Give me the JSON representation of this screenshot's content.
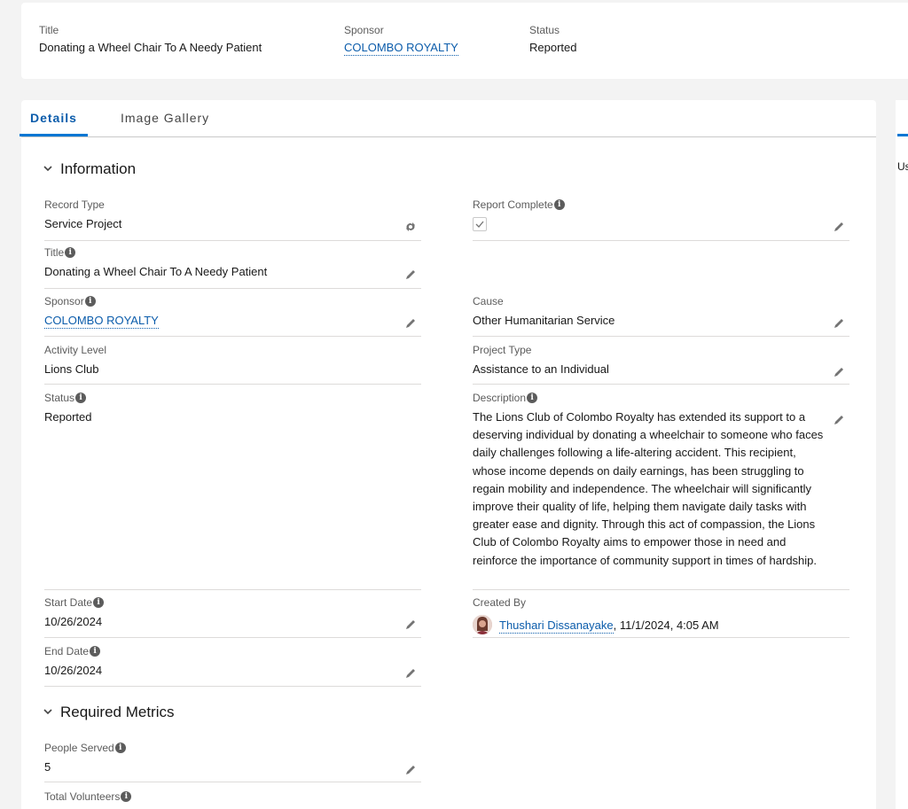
{
  "header": {
    "title_label": "Title",
    "title_value": "Donating a Wheel Chair To A Needy Patient",
    "sponsor_label": "Sponsor",
    "sponsor_value": "COLOMBO ROYALTY",
    "status_label": "Status",
    "status_value": "Reported"
  },
  "tabs": [
    {
      "label": "Details",
      "active": true
    },
    {
      "label": "Image Gallery",
      "active": false
    }
  ],
  "sections": {
    "information": "Information",
    "required_metrics": "Required Metrics"
  },
  "fields": {
    "record_type": {
      "label": "Record Type",
      "value": "Service Project"
    },
    "title": {
      "label": "Title",
      "value": "Donating a Wheel Chair To A Needy Patient"
    },
    "sponsor": {
      "label": "Sponsor",
      "value": "COLOMBO ROYALTY"
    },
    "activity_level": {
      "label": "Activity Level",
      "value": "Lions Club"
    },
    "status": {
      "label": "Status",
      "value": "Reported"
    },
    "start_date": {
      "label": "Start Date",
      "value": "10/26/2024"
    },
    "end_date": {
      "label": "End Date",
      "value": "10/26/2024"
    },
    "report_complete": {
      "label": "Report Complete",
      "checked": true
    },
    "cause": {
      "label": "Cause",
      "value": "Other Humanitarian Service"
    },
    "project_type": {
      "label": "Project Type",
      "value": "Assistance to an Individual"
    },
    "description": {
      "label": "Description",
      "value": "The Lions Club of Colombo Royalty has extended its support to a deserving individual by donating a wheelchair to someone who faces daily challenges following a life-altering accident. This recipient, whose income depends on daily earnings, has been struggling to regain mobility and independence. The wheelchair will significantly improve their quality of life, helping them navigate daily tasks with greater ease and dignity. Through this act of compassion, the Lions Club of Colombo Royalty aims to empower those in need and reinforce the importance of community support in times of hardship."
    },
    "created_by": {
      "label": "Created By",
      "user": "Thushari Dissanayake",
      "timestamp": ", 11/1/2024, 4:05 AM"
    },
    "people_served": {
      "label": "People Served",
      "value": "5"
    },
    "total_volunteers": {
      "label": "Total Volunteers"
    }
  },
  "right_panel": {
    "stub_text": "Us"
  },
  "colors": {
    "accent": "#0176d3",
    "link": "#0b5cab"
  },
  "icons": [
    "info-icon",
    "pencil-icon",
    "swap-icon",
    "check-icon",
    "chevron-down-icon"
  ]
}
